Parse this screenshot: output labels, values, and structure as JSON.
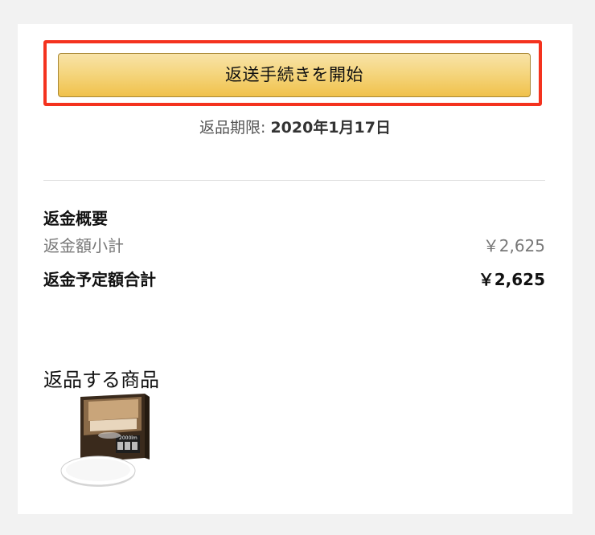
{
  "return": {
    "start_button_label": "返送手続きを開始",
    "deadline_label": "返品期限: ",
    "deadline_date": "2020年1月17日"
  },
  "refund_summary": {
    "title": "返金概要",
    "subtotal_label": "返金額小計",
    "subtotal_value": "￥2,625",
    "total_label": "返金予定額合計",
    "total_value": "￥2,625"
  },
  "items": {
    "title": "返品する商品",
    "products": [
      {
        "icon": "ceiling-light-product-image",
        "box_text": "2000lm"
      }
    ]
  },
  "colors": {
    "highlight_border": "#f4321e",
    "button_gradient_top": "#f8e3a8",
    "button_gradient_bottom": "#f0c14b",
    "button_border": "#a88734",
    "background": "#f2f2f2",
    "card": "#ffffff"
  }
}
